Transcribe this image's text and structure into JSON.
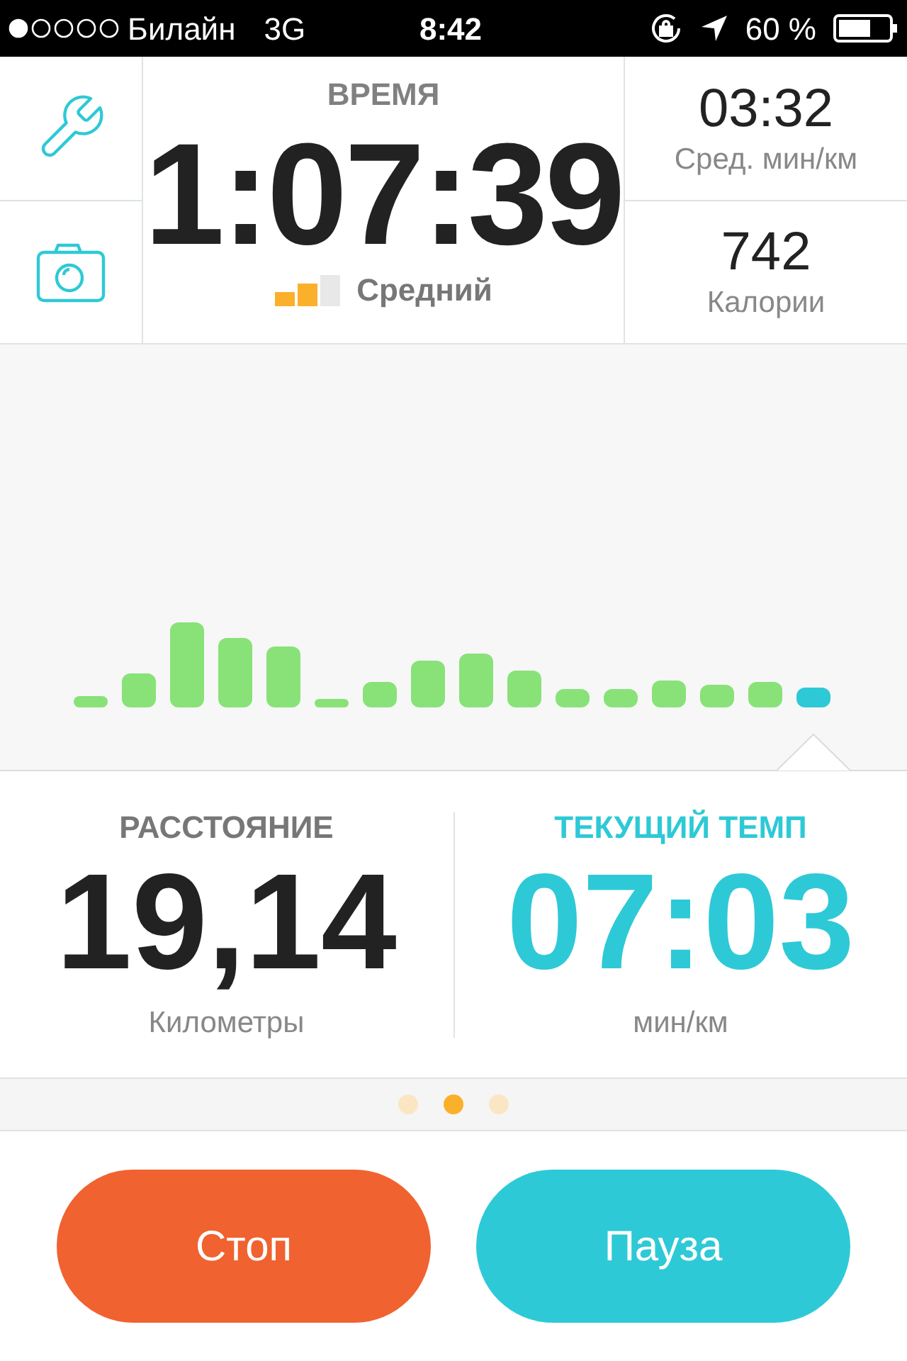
{
  "status_bar": {
    "carrier": "Билайн",
    "network": "3G",
    "time": "8:42",
    "battery": "60 %"
  },
  "sidebar": {
    "buttons": [
      {
        "kind": "settings"
      },
      {
        "kind": "camera"
      }
    ]
  },
  "time": {
    "title": "ВРЕМЯ",
    "value": "1:07:39",
    "intensity": {
      "label": "Средний",
      "level": 0.67
    }
  },
  "stats": [
    {
      "value": "03:32",
      "label": "Сред. мин/км"
    },
    {
      "value": "742",
      "label": "Калории"
    }
  ],
  "metrics": [
    {
      "title": "РАССТОЯНИЕ",
      "value": "19,14",
      "unit": "Километры",
      "highlighted": false
    },
    {
      "title": "ТЕКУЩИЙ ТЕМП",
      "value": "07:03",
      "unit": "мин/км",
      "highlighted": true
    }
  ],
  "pages": [
    {
      "selected": false
    },
    {
      "selected": true
    },
    {
      "selected": false
    }
  ],
  "buttons": [
    {
      "label": "Стоп",
      "kind": "stop"
    },
    {
      "label": "Пауза",
      "kind": "pause"
    }
  ]
}
